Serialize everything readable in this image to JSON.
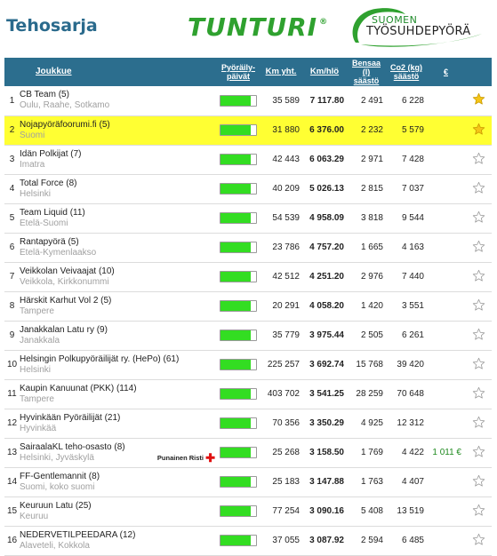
{
  "page": {
    "title": "Tehosarja"
  },
  "logos": {
    "tunturi": "TUNTURI",
    "tunturi_reg": "®",
    "tsp_line1": "SUOMEN",
    "tsp_line2": "TYÖSUHDEPYÖRÄ"
  },
  "table": {
    "headers": {
      "team": "Joukkue",
      "days1": "Pyöräily-",
      "days2": "päivät",
      "km_total": "Km yht.",
      "km_per_day": "Km/hlö",
      "gas1": "Bensaa (l)",
      "gas2": "säästö",
      "co2_1": "Co2 (kg)",
      "co2_2": "säästö",
      "euro": "€"
    },
    "rows": [
      {
        "rank": "1",
        "name": "CB Team (5)",
        "location": "Oulu, Raahe, Sotkamo",
        "progress": 0.85,
        "km_total": "35 589",
        "km_per_person": "7 117.80",
        "gas_saved": "2 491",
        "co2_saved": "6 228",
        "money": "",
        "starred": true,
        "highlight": false
      },
      {
        "rank": "2",
        "name": "Nojapyöräfoorumi.fi (5)",
        "location": "Suomi",
        "progress": 0.85,
        "km_total": "31 880",
        "km_per_person": "6 376.00",
        "gas_saved": "2 232",
        "co2_saved": "5 579",
        "money": "",
        "starred": true,
        "highlight": true
      },
      {
        "rank": "3",
        "name": "Idän Polkijat (7)",
        "location": "Imatra",
        "progress": 0.85,
        "km_total": "42 443",
        "km_per_person": "6 063.29",
        "gas_saved": "2 971",
        "co2_saved": "7 428",
        "money": "",
        "starred": false,
        "highlight": false
      },
      {
        "rank": "4",
        "name": "Total Force (8)",
        "location": "Helsinki",
        "progress": 0.85,
        "km_total": "40 209",
        "km_per_person": "5 026.13",
        "gas_saved": "2 815",
        "co2_saved": "7 037",
        "money": "",
        "starred": false,
        "highlight": false
      },
      {
        "rank": "5",
        "name": "Team Liquid (11)",
        "location": "Etelä-Suomi",
        "progress": 0.85,
        "km_total": "54 539",
        "km_per_person": "4 958.09",
        "gas_saved": "3 818",
        "co2_saved": "9 544",
        "money": "",
        "starred": false,
        "highlight": false
      },
      {
        "rank": "6",
        "name": "Rantapyörä (5)",
        "location": "Etelä-Kymenlaakso",
        "progress": 0.85,
        "km_total": "23 786",
        "km_per_person": "4 757.20",
        "gas_saved": "1 665",
        "co2_saved": "4 163",
        "money": "",
        "starred": false,
        "highlight": false
      },
      {
        "rank": "7",
        "name": "Veikkolan Veivaajat (10)",
        "location": "Veikkola, Kirkkonummi",
        "progress": 0.85,
        "km_total": "42 512",
        "km_per_person": "4 251.20",
        "gas_saved": "2 976",
        "co2_saved": "7 440",
        "money": "",
        "starred": false,
        "highlight": false
      },
      {
        "rank": "8",
        "name": "Härskit Karhut Vol 2 (5)",
        "location": "Tampere",
        "progress": 0.85,
        "km_total": "20 291",
        "km_per_person": "4 058.20",
        "gas_saved": "1 420",
        "co2_saved": "3 551",
        "money": "",
        "starred": false,
        "highlight": false
      },
      {
        "rank": "9",
        "name": "Janakkalan Latu ry (9)",
        "location": "Janakkala",
        "progress": 0.85,
        "km_total": "35 779",
        "km_per_person": "3 975.44",
        "gas_saved": "2 505",
        "co2_saved": "6 261",
        "money": "",
        "starred": false,
        "highlight": false
      },
      {
        "rank": "10",
        "name": "Helsingin Polkupyöräilijät ry. (HePo) (61)",
        "location": "Helsinki",
        "progress": 0.85,
        "km_total": "225 257",
        "km_per_person": "3 692.74",
        "gas_saved": "15 768",
        "co2_saved": "39 420",
        "money": "",
        "starred": false,
        "highlight": false
      },
      {
        "rank": "11",
        "name": "Kaupin Kanuunat (PKK) (114)",
        "location": "Tampere",
        "progress": 0.85,
        "km_total": "403 702",
        "km_per_person": "3 541.25",
        "gas_saved": "28 259",
        "co2_saved": "70 648",
        "money": "",
        "starred": false,
        "highlight": false
      },
      {
        "rank": "12",
        "name": "Hyvinkään Pyöräilijät (21)",
        "location": "Hyvinkää",
        "progress": 0.85,
        "km_total": "70 356",
        "km_per_person": "3 350.29",
        "gas_saved": "4 925",
        "co2_saved": "12 312",
        "money": "",
        "starred": false,
        "highlight": false
      },
      {
        "rank": "13",
        "name": "SairaalaKL teho-osasto (8)",
        "location": "Helsinki, Jyväskylä",
        "progress": 0.85,
        "km_total": "25 268",
        "km_per_person": "3 158.50",
        "gas_saved": "1 769",
        "co2_saved": "4 422",
        "money": "1 011 €",
        "starred": false,
        "highlight": false,
        "badge": "Punainen Risti"
      },
      {
        "rank": "14",
        "name": "FF-Gentlemannit (8)",
        "location": "Suomi, koko suomi",
        "progress": 0.85,
        "km_total": "25 183",
        "km_per_person": "3 147.88",
        "gas_saved": "1 763",
        "co2_saved": "4 407",
        "money": "",
        "starred": false,
        "highlight": false
      },
      {
        "rank": "15",
        "name": "Keuruun Latu (25)",
        "location": "Keuruu",
        "progress": 0.85,
        "km_total": "77 254",
        "km_per_person": "3 090.16",
        "gas_saved": "5 408",
        "co2_saved": "13 519",
        "money": "",
        "starred": false,
        "highlight": false
      },
      {
        "rank": "16",
        "name": "NEDERVETILPEEDARA (12)",
        "location": "Alaveteli, Kokkola",
        "progress": 0.85,
        "km_total": "37 055",
        "km_per_person": "3 087.92",
        "gas_saved": "2 594",
        "co2_saved": "6 485",
        "money": "",
        "starred": false,
        "highlight": false
      }
    ]
  },
  "colors": {
    "header_bg": "#2c6e8e",
    "highlight": "#ffff33",
    "bar_fill": "#33dd22",
    "star_gold": "#f5c518",
    "money": "#1f8a1f",
    "brand_green": "#2fa12f"
  },
  "icons": {
    "star_filled": "star-filled-icon",
    "star_empty": "star-outline-icon",
    "red_cross": "red-cross-icon"
  }
}
